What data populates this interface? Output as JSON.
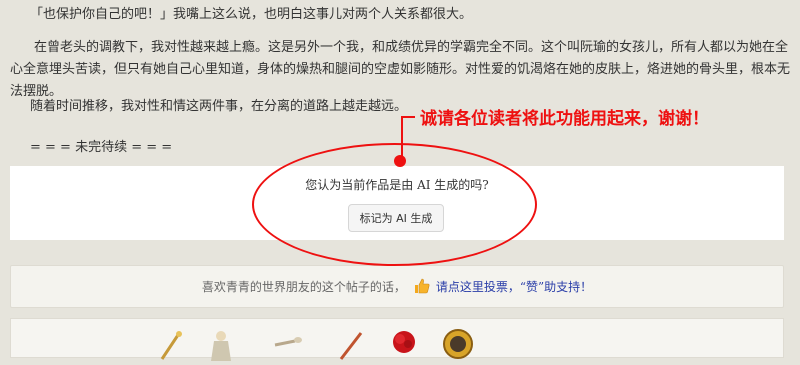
{
  "story": {
    "p1": "「也保护你自己的吧！」我嘴上这么说，也明白这事儿对两个人关系都很大。",
    "p2": "在曾老头的调教下，我对性越来越上瘾。这是另外一个我，和成绩优异的学霸完全不同。这个叫阮瑜的女孩儿，所有人都以为她在全心全意埋头苦读，但只有她自己心里知道，身体的燥热和腿间的空虚如影随形。对性爱的饥渴烙在她的皮肤上，烙进她的骨头里，根本无法摆脱。",
    "p3": "随着时间推移，我对性和情这两件事，在分离的道路上越走越远。",
    "p4": "= = = 未完待续 = = ="
  },
  "ai_check": {
    "question": "您认为当前作品是由 AI 生成的吗?",
    "button_label": "标记为 AI 生成"
  },
  "vote": {
    "lead": "喜欢青青的世界朋友的这个帖子的话，",
    "link": "请点这里投票，“赞”助支持！",
    "icon": "thumbs-up-icon"
  },
  "annotation": {
    "text": "诚请各位读者将此功能用起来，谢谢！",
    "color": "#e11111"
  },
  "gifts": [
    "wand-icon",
    "figure-icon",
    "pipe-icon",
    "sword-icon",
    "rose-icon",
    "medal-icon"
  ]
}
